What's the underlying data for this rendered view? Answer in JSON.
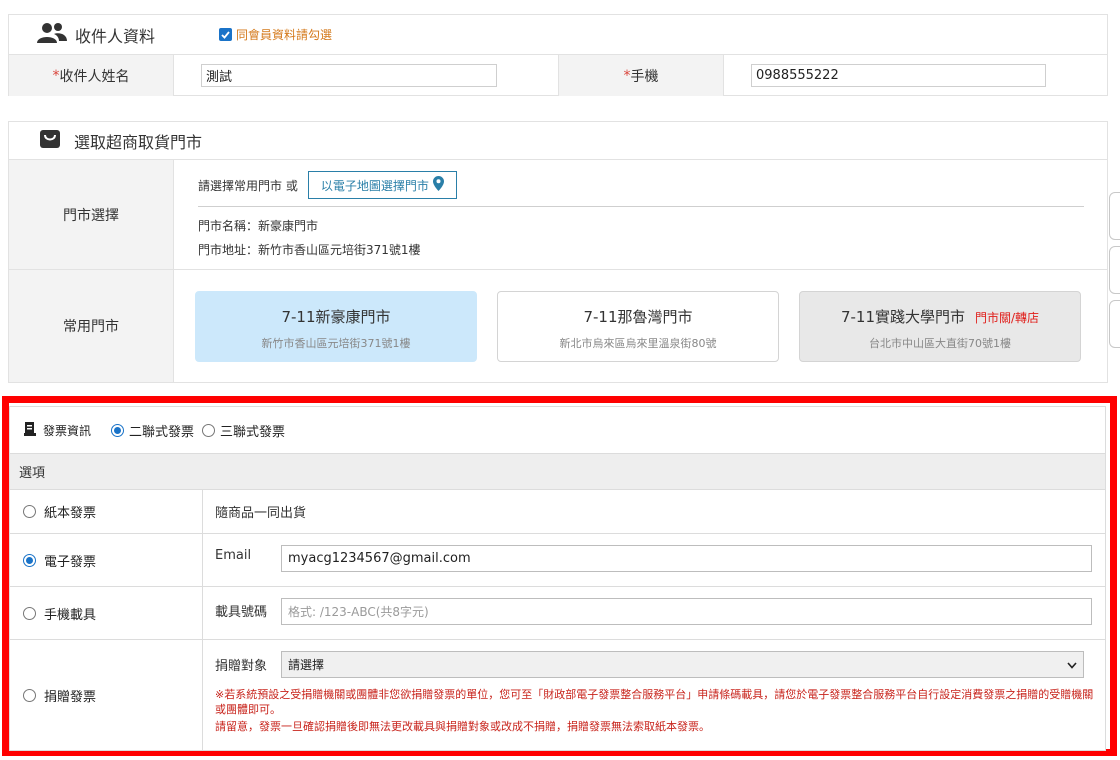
{
  "recipient": {
    "title": "收件人資料",
    "same_member_label": "同會員資料請勾選",
    "same_member_checked": true,
    "name_label": "收件人姓名",
    "name_required_mark": "*",
    "name_value": "測試",
    "phone_label": "手機",
    "phone_required_mark": "*",
    "phone_value": "0988555222"
  },
  "store_pickup": {
    "title": "選取超商取貨門市",
    "store_select_label": "門市選擇",
    "choose_prompt": "請選擇常用門市 或",
    "map_button_label": "以電子地圖選擇門市",
    "store_name_line": "門市名稱：新豪康門市",
    "store_address_line": "門市地址：新竹市香山區元培街371號1樓",
    "common_stores_label": "常用門市",
    "common_stores": [
      {
        "name": "7-11新豪康門市",
        "address": "新竹市香山區元培街371號1樓",
        "status": "",
        "selected": true
      },
      {
        "name": "7-11那魯灣門市",
        "address": "新北市烏來區烏來里溫泉街80號",
        "status": "",
        "selected": false
      },
      {
        "name": "7-11實踐大學門市",
        "address": "台北市中山區大直街70號1樓",
        "status": "門市關/轉店",
        "selected": false
      }
    ]
  },
  "invoice": {
    "title": "發票資訊",
    "type_options": [
      {
        "label": "二聯式發票",
        "selected": true
      },
      {
        "label": "三聯式發票",
        "selected": false
      }
    ],
    "options_header": "選項",
    "paper": {
      "label": "紙本發票",
      "selected": false,
      "desc": "隨商品一同出貨"
    },
    "electronic": {
      "label": "電子發票",
      "selected": true,
      "field_label": "Email",
      "field_value": "myacg1234567@gmail.com"
    },
    "mobile": {
      "label": "手機載具",
      "selected": false,
      "field_label": "載具號碼",
      "placeholder": "格式: /123-ABC(共8字元)"
    },
    "donation": {
      "label": "捐贈發票",
      "selected": false,
      "field_label": "捐贈對象",
      "select_value": "請選擇",
      "note_1": "※若系統預設之受捐贈機關或團體非您欲捐贈發票的單位，您可至「財政部電子發票整合服務平台」申請條碼載具，請您於電子發票整合服務平台自行設定消費發票之捐贈的受贈機關或團體即可。",
      "note_2": "請留意，發票一旦確認捐贈後即無法更改載具與捐贈對象或改成不捐贈，捐贈發票無法索取紙本發票。"
    }
  },
  "colors": {
    "highlight_frame": "#ff0000",
    "selected_store_bg": "#cce8fb",
    "closed_store_bg": "#e8e8e8",
    "accent_blue": "#1a73c8",
    "warning_red": "#c8241c"
  }
}
